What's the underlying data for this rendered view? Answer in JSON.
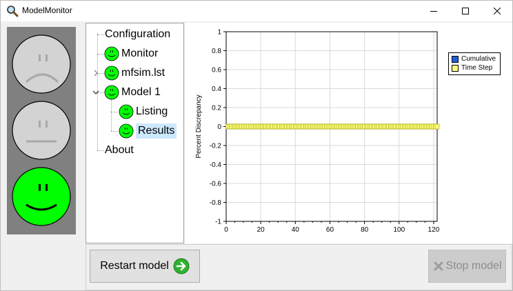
{
  "window": {
    "title": "ModelMonitor",
    "app_icon": "magnifier-icon",
    "controls": [
      "minimize-icon",
      "maximize-icon",
      "close-icon"
    ]
  },
  "status_lights": [
    {
      "state": "sad",
      "active": false,
      "color": "#d3d3d3"
    },
    {
      "state": "neutral",
      "active": false,
      "color": "#d3d3d3"
    },
    {
      "state": "happy",
      "active": true,
      "color": "#00ff00"
    }
  ],
  "tree": {
    "items": [
      {
        "label": "Configuration",
        "icon": null,
        "depth": 0
      },
      {
        "label": "Monitor",
        "icon": "green-smiley-icon",
        "depth": 0
      },
      {
        "label": "mfsim.lst",
        "icon": "green-smiley-icon",
        "depth": 0,
        "expander": "collapsed"
      },
      {
        "label": "Model 1",
        "icon": "green-smiley-icon",
        "depth": 0,
        "expander": "expanded"
      },
      {
        "label": "Listing",
        "icon": "green-smiley-icon",
        "depth": 1
      },
      {
        "label": "Results",
        "icon": "green-smiley-icon",
        "depth": 1,
        "selected": true
      },
      {
        "label": "About",
        "icon": null,
        "depth": 0
      }
    ]
  },
  "chart_data": {
    "type": "line",
    "title": "",
    "xlabel": "",
    "ylabel": "Percent Discrepancy",
    "xlim": [
      0,
      122
    ],
    "ylim": [
      -1,
      1
    ],
    "xticks": [
      0,
      20,
      40,
      60,
      80,
      100,
      120
    ],
    "yticks": [
      -1,
      -0.8,
      -0.6,
      -0.4,
      -0.2,
      0,
      0.2,
      0.4,
      0.6,
      0.8,
      1
    ],
    "ytick_labels": [
      "-1",
      "-0.8",
      "-0.6",
      "-0.4",
      "-0.2",
      "0",
      "0.2",
      "0.4",
      "0.6",
      "0.8",
      "1"
    ],
    "grid": true,
    "legend_position": "top-right",
    "series": [
      {
        "name": "Cumulative",
        "color": "#1f5fd6",
        "marker": "square",
        "x_range": [
          1,
          122
        ],
        "value": 0
      },
      {
        "name": "Time Step",
        "color": "#ffff80",
        "marker": "square",
        "x_range": [
          1,
          122
        ],
        "value": 0
      }
    ]
  },
  "buttons": {
    "restart_label": "Restart model",
    "restart_icon": "green-arrow-right-icon",
    "stop_label": "Stop model",
    "stop_icon": "stop-x-icon",
    "stop_enabled": false
  }
}
